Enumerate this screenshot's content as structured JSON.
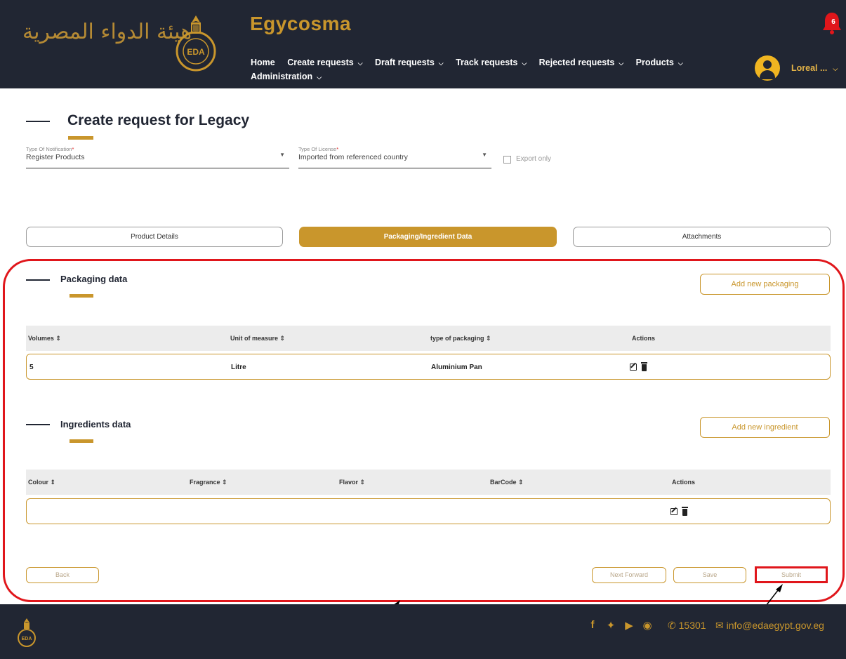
{
  "header": {
    "arabic_logo_text": "هيئة الدواء المصرية",
    "brand": "Egycosma",
    "nav": [
      {
        "label": "Home",
        "has_dropdown": false
      },
      {
        "label": "Create requests",
        "has_dropdown": true
      },
      {
        "label": "Draft requests",
        "has_dropdown": true
      },
      {
        "label": "Track requests",
        "has_dropdown": true
      },
      {
        "label": "Rejected requests",
        "has_dropdown": true
      },
      {
        "label": "Products",
        "has_dropdown": true
      },
      {
        "label": "Administration",
        "has_dropdown": true
      }
    ],
    "notification_count": "6",
    "user_name": "Loreal ..."
  },
  "page": {
    "title": "Create request for Legacy"
  },
  "form": {
    "notification_type": {
      "label": "Type Of Notification",
      "value": "Register Products"
    },
    "license_type": {
      "label": "Type Of License",
      "value": "Imported from referenced country"
    },
    "export_only": {
      "label": "Export only",
      "checked": false
    }
  },
  "tabs": [
    {
      "label": "Product Details",
      "active": false
    },
    {
      "label": "Packaging/Ingredient Data",
      "active": true
    },
    {
      "label": "Attachments",
      "active": false
    }
  ],
  "packaging": {
    "title": "Packaging data",
    "add_label": "Add new packaging",
    "columns": [
      "Volumes ⇕",
      "Unit of measure ⇕",
      "type of packaging ⇕",
      "Actions"
    ],
    "rows": [
      {
        "volume": "5",
        "unit": "Litre",
        "type": "Aluminium Pan"
      }
    ]
  },
  "ingredients": {
    "title": "Ingredients data",
    "add_label": "Add new ingredient",
    "columns": [
      "Colour ⇕",
      "Fragrance ⇕",
      "Flavor ⇕",
      "BarCode ⇕",
      "Actions"
    ],
    "rows": [
      {
        "colour": "",
        "fragrance": "",
        "flavor": "",
        "barcode": ""
      }
    ]
  },
  "actions": {
    "back": "Back",
    "next": "Next Forward",
    "save": "Save",
    "submit": "Submit"
  },
  "footer": {
    "social_icons": [
      "facebook-icon",
      "twitter-icon",
      "youtube-icon",
      "instagram-icon"
    ],
    "phone": "15301",
    "email": "info@edaegypt.gov.eg"
  },
  "colors": {
    "navy": "#212633",
    "gold": "#c9962c",
    "annotation_red": "#e0161b",
    "bell_red": "#e0161b",
    "avatar_yellow": "#f0b521"
  }
}
